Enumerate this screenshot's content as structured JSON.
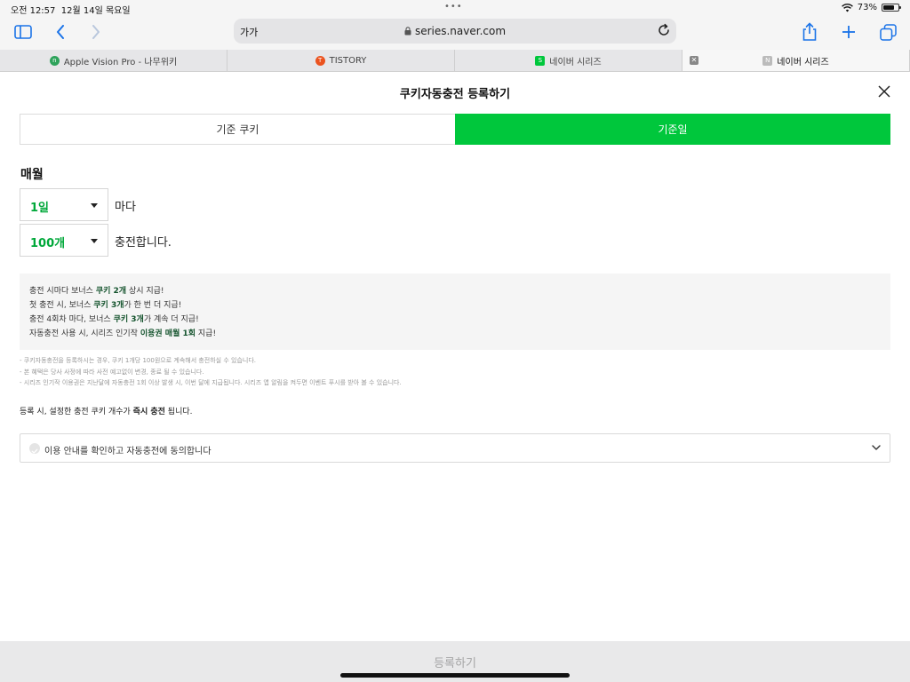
{
  "status_bar": {
    "time": "오전 12:57",
    "date": "12월 14일 목요일",
    "dots": "•••",
    "battery_percent": "73%",
    "battery_level": 0.73
  },
  "browser": {
    "reader_label": "가가",
    "url": "series.naver.com",
    "tabs": [
      {
        "title": "Apple Vision Pro - 나무위키",
        "favicon": "namuwiki-icon",
        "favicon_color": "#2ea35b"
      },
      {
        "title": "TISTORY",
        "favicon": "tistory-icon",
        "favicon_color": "#eb531f"
      },
      {
        "title": "네이버 시리즈",
        "favicon": "naver-series-icon",
        "favicon_color": "#00c73c"
      },
      {
        "title": "네이버 시리즈",
        "favicon": "naver-series-icon",
        "favicon_color": "#bbbbbb",
        "active": true
      }
    ],
    "tab_close": "✕"
  },
  "modal": {
    "title": "쿠키자동충전 등록하기",
    "tabs": [
      {
        "label": "기준 쿠키",
        "selected": false
      },
      {
        "label": "기준일",
        "selected": true
      }
    ],
    "section_label": "매월",
    "day_select": {
      "value": "1일",
      "suffix": "마다"
    },
    "amount_select": {
      "value": "100개",
      "suffix": "충전합니다."
    },
    "info": [
      {
        "pre": "충전 시마다 보너스 ",
        "bold": "쿠키 2개",
        "post": " 상시 지급!"
      },
      {
        "pre": "첫 충전 시, 보너스 ",
        "bold": "쿠키 3개",
        "post": "가 한 번 더 지급!"
      },
      {
        "pre": "충전 4회차 마다, 보너스 ",
        "bold": "쿠키 3개",
        "post": "가 계속 더 지급!"
      },
      {
        "pre": "자동충전 사용 시, 시리즈 인기작 ",
        "bold": "이용권 매월 1회",
        "post": " 지급!"
      }
    ],
    "notes": [
      "- 쿠키자동충전을 등록하시는 경우, 쿠키 1개당 100원으로 계속해서 충전하실 수 있습니다.",
      "- 본 혜택은 당사 사정에 따라 사전 예고없이 변경, 종료 될 수 있습니다.",
      "- 시리즈 인기작 이용권은 지난달에 자동충전 1회 이상 발생 시, 이번 달에 지급됩니다. 시리즈 앱 알림을 켜두면 이벤트 푸시를 받아 볼 수 있습니다."
    ],
    "instant": {
      "pre": "등록 시, 설정한 충전 쿠키 개수가 ",
      "bold": "즉시 충전",
      "post": " 됩니다."
    },
    "agree_label": "이용 안내를 확인하고 자동충전에 동의합니다",
    "submit_label": "등록하기"
  },
  "colors": {
    "accent": "#00c73c",
    "accent_text": "#00a83a",
    "bold_green": "#14532d"
  }
}
